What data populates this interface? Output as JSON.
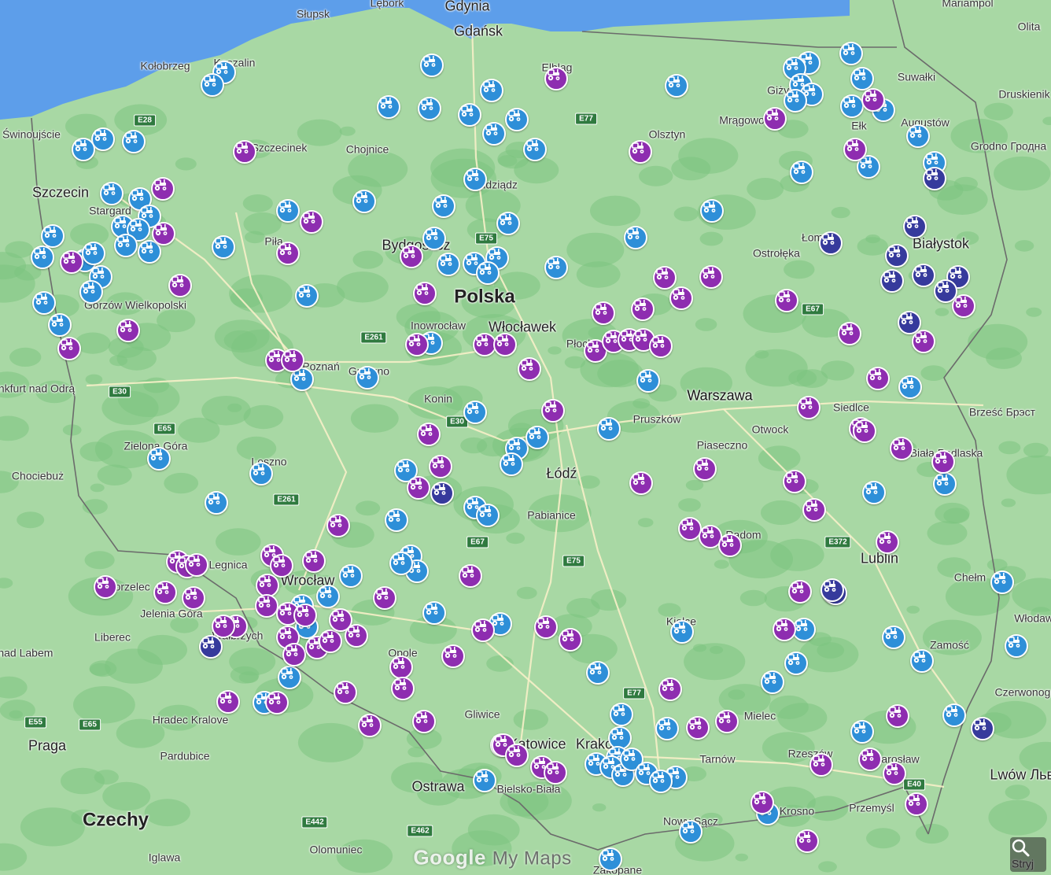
{
  "map": {
    "watermark": {
      "brand": "Google",
      "product": "My Maps"
    },
    "colors": {
      "sea": "#5d9eea",
      "land": "#a8d8a4",
      "forest": "#7cc47f",
      "border": "#6b6b6b",
      "marker_blue": "#2e8fd8",
      "marker_purple": "#8e2db0",
      "marker_navy": "#363a9c"
    },
    "marker_icon": "tractor-icon",
    "countries": [
      {
        "text": "Polska",
        "style": "big"
      },
      {
        "text": "Czechy",
        "style": "big"
      }
    ],
    "places": [
      "Słupsk",
      "Gdynia",
      "Gdańsk",
      "Lębork",
      "Kołobrzeg",
      "Koszalin",
      "Elbląg",
      "Olita",
      "Suwałki",
      "Druskienik",
      "Świnoujście",
      "Szczecinek",
      "Chojnice",
      "Olsztyn",
      "Mrągowo",
      "Giżycko",
      "Ełk",
      "Augustów",
      "Grodno Гродна",
      "Szczecin",
      "Stargard",
      "Grudziądz",
      "Bydgoszcz",
      "Piła",
      "Ostrołęka",
      "Łomża",
      "Białystok",
      "Gorzów Wielkopolski",
      "Inowrocław",
      "Włocławek",
      "Płock",
      "Frankfurt nad Odrą",
      "Gniezno",
      "Poznań",
      "Warszawa",
      "Siedlce",
      "Konin",
      "Pruszków",
      "Otwock",
      "Brześć Брэст",
      "Zielona Góra",
      "Piaseczno",
      "Biała Podlaska",
      "Leszno",
      "Łódź",
      "Chociebuż",
      "Pabianice",
      "Radom",
      "Lublin",
      "Legnica",
      "Chełm",
      "Zgorzelec",
      "Wrocław",
      "Jelenia Góra",
      "Liberec",
      "Wałbrzych",
      "Katowice",
      "Kielce",
      "Zamość",
      "Opole",
      "Gliwice",
      "Mielec",
      "Hradec Kralove",
      "Kraków",
      "Tarnów",
      "Rzeszów",
      "Jarosław",
      "Praga",
      "Pardubice",
      "Ostrawa",
      "Bielsko-Biała",
      "Krosno",
      "Przemyśl",
      "Olomuniec",
      "Nowy Sącz",
      "Iglawa",
      "Zakopane",
      "Lwów Львів",
      "Włodawa",
      "Czerwonogród",
      "Stryj",
      "Mariampol",
      "Ústí nad Labem"
    ],
    "roads": [
      "E28",
      "E77",
      "E75",
      "E67",
      "E261",
      "E30",
      "E65",
      "E261",
      "E67",
      "E75",
      "E372",
      "E55",
      "E65",
      "E77",
      "E442",
      "E462",
      "E40",
      "E30"
    ],
    "markers": {
      "blue": 120,
      "purple": 105,
      "navy": 14
    }
  }
}
